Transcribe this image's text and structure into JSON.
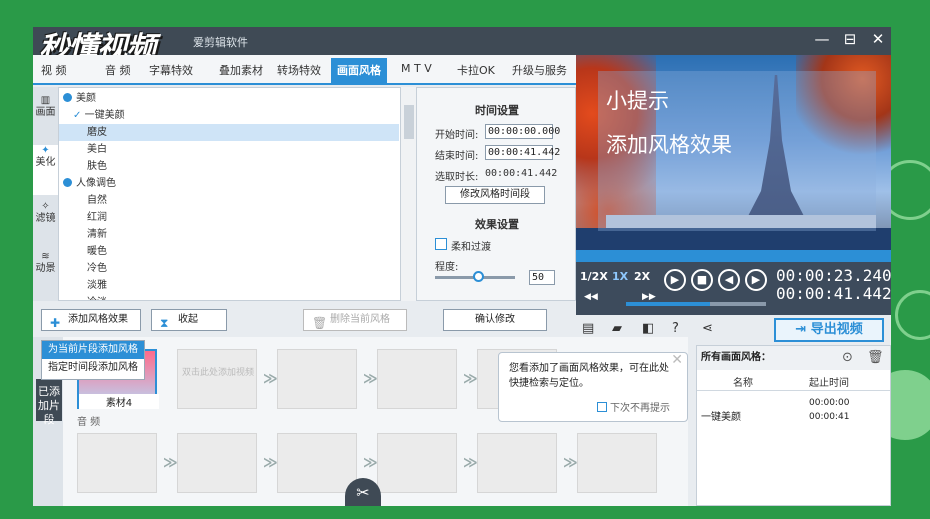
{
  "window": {
    "watermark": "秒懂视频",
    "app_title_fragment": "爱剪辑软件",
    "controls": {
      "minimize": "—",
      "maximize": "⊟",
      "close": "✕"
    }
  },
  "tabs": [
    {
      "label": "视 频"
    },
    {
      "label": "音 频"
    },
    {
      "label": "字幕特效"
    },
    {
      "label": "叠加素材"
    },
    {
      "label": "转场特效"
    },
    {
      "label": "画面风格"
    },
    {
      "label": "M T V"
    },
    {
      "label": "卡拉OK"
    },
    {
      "label": "升级与服务"
    }
  ],
  "side_tabs": [
    {
      "label": "画面"
    },
    {
      "label": "美化"
    },
    {
      "label": "滤镜"
    },
    {
      "label": "动景"
    }
  ],
  "tree": {
    "category1": "美颜",
    "checked_item": "一键美颜",
    "items1": [
      "磨皮",
      "美白",
      "肤色"
    ],
    "category2": "人像调色",
    "items2": [
      "自然",
      "红润",
      "清新",
      "暖色",
      "冷色",
      "淡雅",
      "冷淡"
    ]
  },
  "settings": {
    "time_header": "时间设置",
    "start_label": "开始时间:",
    "start_value": "00:00:00.000",
    "end_label": "结束时间:",
    "end_value": "00:00:41.442",
    "duration_label": "选取时长:",
    "duration_value": "00:00:41.442",
    "modify_button": "修改风格时间段",
    "effect_header": "效果设置",
    "fade_label": "柔和过渡",
    "degree_label": "程度:",
    "degree_value": "50"
  },
  "actions": {
    "add_effect": "添加风格效果",
    "collapse": "收起",
    "delete": "删除当前风格",
    "confirm": "确认修改"
  },
  "dropdown": {
    "items": [
      "为当前片段添加风格",
      "指定时间段添加风格"
    ]
  },
  "preview": {
    "tip_line1": "小提示",
    "tip_line2": "添加风格效果"
  },
  "player": {
    "speeds": [
      "1/2X",
      "1X",
      "2X"
    ],
    "current_time": "00:00:23.240",
    "total_time": "00:00:41.442"
  },
  "export_button": "导出视频",
  "storyboard": {
    "tab_label": "已添加片段",
    "clip_label": "素材4",
    "placeholder": "双击此处添加视频",
    "audio_label": "音 频"
  },
  "hint": {
    "text": "您看添加了画面风格效果，可在此处快捷检索与定位。",
    "checkbox": "下次不再提示"
  },
  "right_panel": {
    "header": "所有画面风格：",
    "col_name": "名称",
    "col_time": "起止时间",
    "row_name": "一键美颜",
    "row_start": "00:00:00",
    "row_end": "00:00:41"
  }
}
